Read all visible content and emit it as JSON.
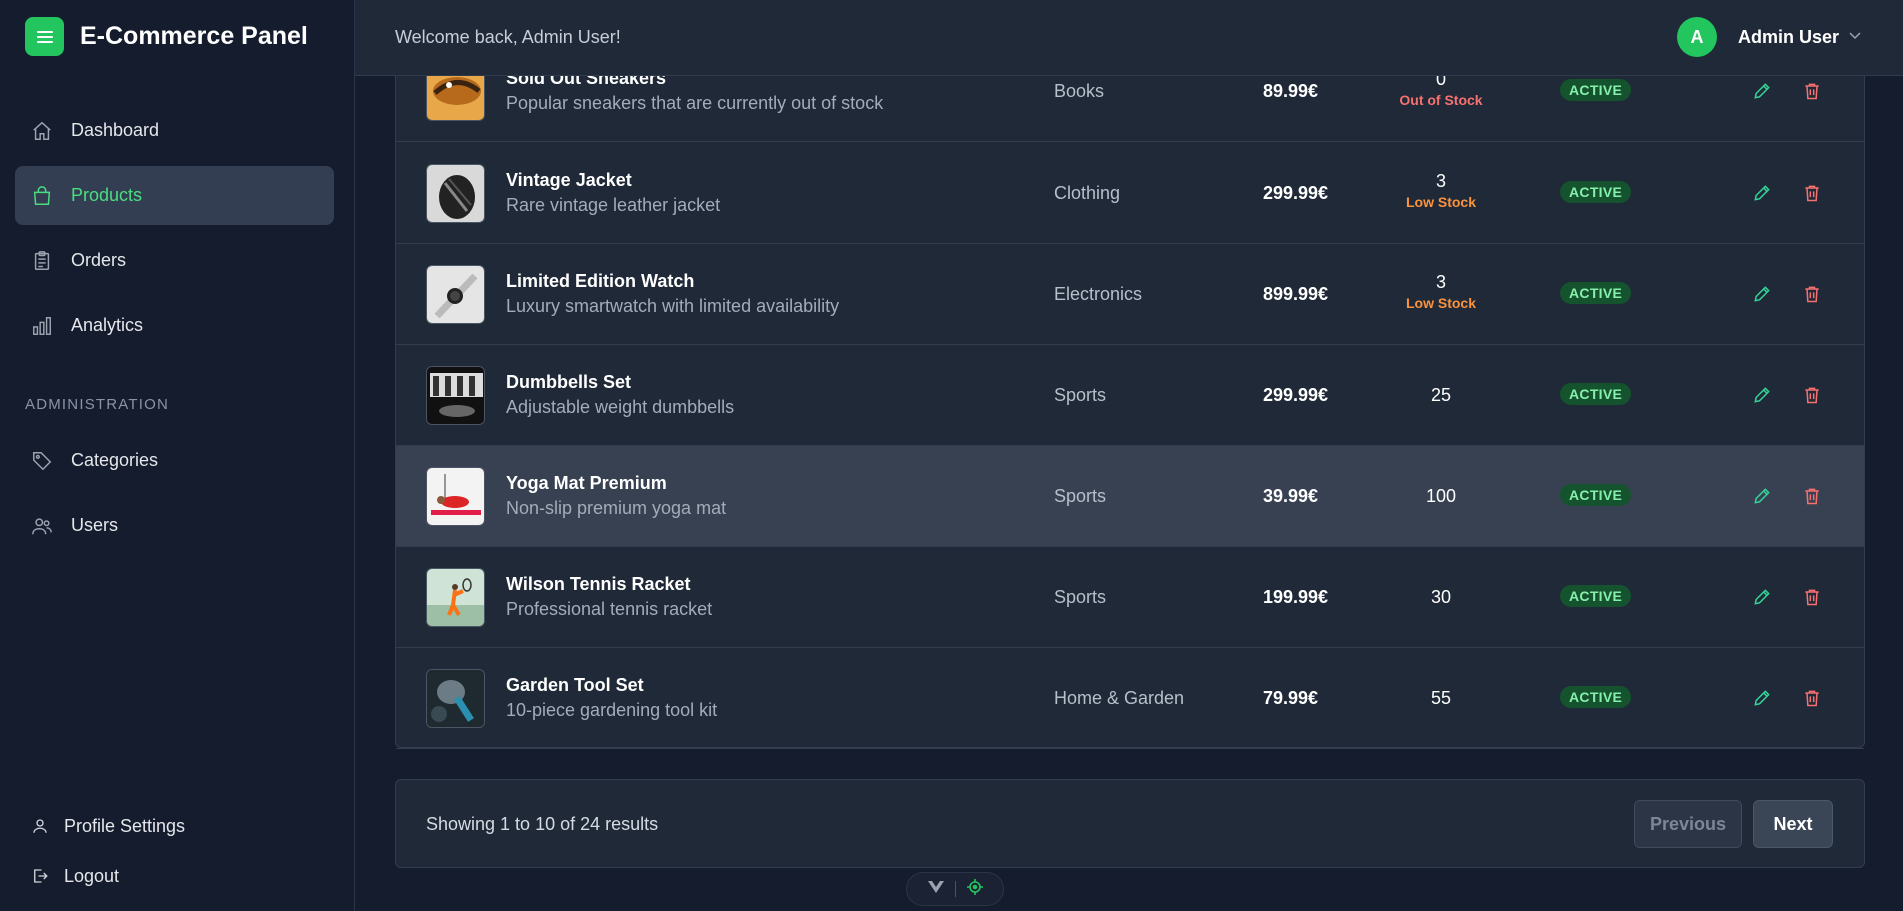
{
  "app": {
    "title": "E-Commerce Panel"
  },
  "header": {
    "welcome": "Welcome back, Admin User!",
    "avatar_initial": "A",
    "user_name": "Admin User"
  },
  "sidebar": {
    "items": [
      {
        "label": "Dashboard",
        "icon": "home-icon"
      },
      {
        "label": "Products",
        "icon": "shopping-bag-icon",
        "active": true
      },
      {
        "label": "Orders",
        "icon": "clipboard-icon"
      },
      {
        "label": "Analytics",
        "icon": "bar-chart-icon"
      }
    ],
    "section_label": "ADMINISTRATION",
    "admin_items": [
      {
        "label": "Categories",
        "icon": "tag-icon"
      },
      {
        "label": "Users",
        "icon": "users-icon"
      }
    ],
    "bottom": {
      "profile": "Profile Settings",
      "logout": "Logout"
    }
  },
  "products": [
    {
      "name": "Sold Out Sneakers",
      "description": "Popular sneakers that are currently out of stock",
      "category": "Books",
      "price": "89.99€",
      "stock": "0",
      "stock_status": "Out of Stock",
      "status": "ACTIVE"
    },
    {
      "name": "Vintage Jacket",
      "description": "Rare vintage leather jacket",
      "category": "Clothing",
      "price": "299.99€",
      "stock": "3",
      "stock_status": "Low Stock",
      "status": "ACTIVE"
    },
    {
      "name": "Limited Edition Watch",
      "description": "Luxury smartwatch with limited availability",
      "category": "Electronics",
      "price": "899.99€",
      "stock": "3",
      "stock_status": "Low Stock",
      "status": "ACTIVE"
    },
    {
      "name": "Dumbbells Set",
      "description": "Adjustable weight dumbbells",
      "category": "Sports",
      "price": "299.99€",
      "stock": "25",
      "stock_status": "",
      "status": "ACTIVE"
    },
    {
      "name": "Yoga Mat Premium",
      "description": "Non-slip premium yoga mat",
      "category": "Sports",
      "price": "39.99€",
      "stock": "100",
      "stock_status": "",
      "status": "ACTIVE"
    },
    {
      "name": "Wilson Tennis Racket",
      "description": "Professional tennis racket",
      "category": "Sports",
      "price": "199.99€",
      "stock": "30",
      "stock_status": "",
      "status": "ACTIVE"
    },
    {
      "name": "Garden Tool Set",
      "description": "10-piece gardening tool kit",
      "category": "Home & Garden",
      "price": "79.99€",
      "stock": "55",
      "stock_status": "",
      "status": "ACTIVE"
    }
  ],
  "pagination": {
    "summary": "Showing 1 to 10 of 24 results",
    "previous": "Previous",
    "next": "Next"
  },
  "colors": {
    "accent": "#22c55e",
    "danger": "#f87171",
    "warning": "#fb923c",
    "background": "#141c2e",
    "panel": "#1f2937"
  }
}
